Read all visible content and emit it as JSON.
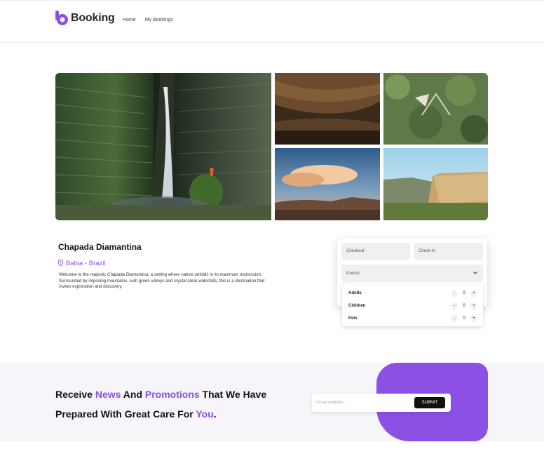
{
  "header": {
    "brand": "Booking",
    "nav": [
      "Home",
      "My Bookings"
    ]
  },
  "gallery": {
    "icons": [
      "waterfall-photo",
      "cave-photo",
      "forest-photo",
      "sunset-plateau-photo",
      "cliff-plateau-photo"
    ]
  },
  "place": {
    "title": "Chapada Diamantina",
    "location": "Bahia - Brazil",
    "description": "Welcome to the majestic Chapada Diamantina, a setting where nature unfolds in its maximum expression. Surrounded by imposing mountains, lush green valleys and crystal-clear waterfalls, this is a destination that invites exploration and discovery."
  },
  "booking": {
    "checkout": "Checkout",
    "checkin": "Check-In",
    "guests": "Guests",
    "rows": [
      {
        "label": "Adults",
        "value": "0"
      },
      {
        "label": "Children",
        "value": "0"
      },
      {
        "label": "Pets",
        "value": "0"
      }
    ],
    "minus": "-",
    "plus": "+"
  },
  "newsletter": {
    "l1a": "Receive ",
    "l1b": "News",
    "l1c": " And ",
    "l1d": "Promotions",
    "l1e": " That We Have",
    "l2a": "Prepared With Great Care For ",
    "l2b": "You",
    "l2c": ".",
    "placeholder": "Email Address...",
    "submit": "SUBMIT"
  },
  "colors": {
    "accent": "#8c50e4",
    "dark": "#111111"
  }
}
